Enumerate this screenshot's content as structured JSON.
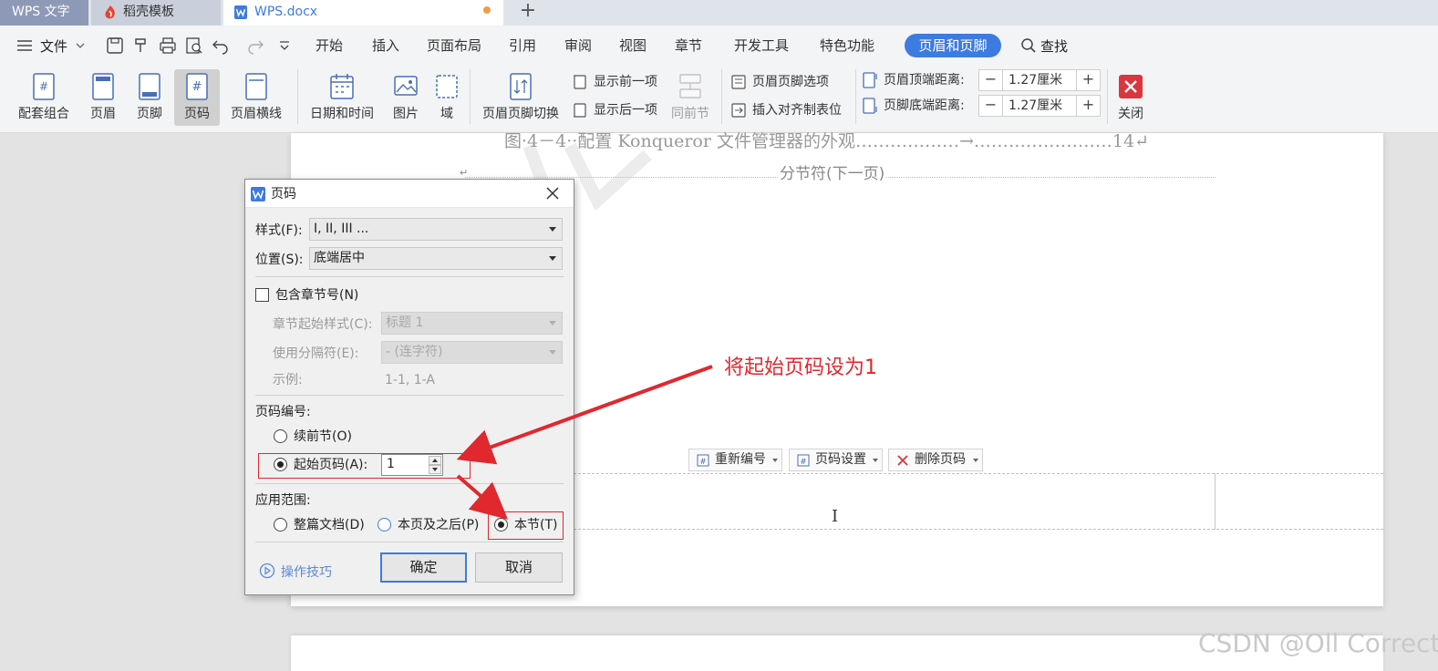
{
  "tabs": [
    {
      "label": "WPS 文字"
    },
    {
      "label": "稻壳模板"
    },
    {
      "label": "WPS.docx"
    }
  ],
  "menubar": {
    "file_label": "文件",
    "items": [
      "开始",
      "插入",
      "页面布局",
      "引用",
      "审阅",
      "视图",
      "章节",
      "开发工具",
      "特色功能"
    ],
    "active_tab": "页眉和页脚",
    "search_label": "查找"
  },
  "ribbon": {
    "large_buttons": [
      "配套组合",
      "页眉",
      "页脚",
      "页码",
      "页眉横线",
      "日期和时间",
      "图片",
      "域",
      "页眉页脚切换",
      "同前节",
      "关闭"
    ],
    "small_buttons": [
      "显示前一项",
      "显示后一项",
      "页眉页脚选项",
      "插入对齐制表位"
    ],
    "header_top_label": "页眉顶端距离:",
    "header_top_value": "1.27厘米",
    "footer_bottom_label": "页脚底端距离:",
    "footer_bottom_value": "1.27厘米"
  },
  "document": {
    "toc_line": "图·4－4··配置 Konqueror 文件管理器的外观………………→……………………14↵",
    "section_break": "分节符(下一页)",
    "paragraph_mark": "↵",
    "cursor": "I",
    "footer_buttons": [
      "重新编号",
      "页码设置",
      "删除页码"
    ]
  },
  "dialog": {
    "title": "页码",
    "style_label": "样式(F):",
    "style_value": "I, II, III ...",
    "position_label": "位置(S):",
    "position_value": "底端居中",
    "include_chapter_label": "包含章节号(N)",
    "chapter_style_label": "章节起始样式(C):",
    "chapter_style_value": "标题 1",
    "separator_label": "使用分隔符(E):",
    "separator_value": "-   (连字符)",
    "example_label": "示例:",
    "example_value": "1-1, 1-A",
    "numbering_header": "页码编号:",
    "continue_label": "续前节(O)",
    "start_label": "起始页码(A):",
    "start_value": "1",
    "scope_header": "应用范围:",
    "scope_whole": "整篇文档(D)",
    "scope_after": "本页及之后(P)",
    "scope_section": "本节(T)",
    "tips_label": "操作技巧",
    "ok_label": "确定",
    "cancel_label": "取消"
  },
  "annotation": {
    "text": "将起始页码设为1"
  },
  "watermark": "CSDN @Oll Correct",
  "colors": {
    "accent": "#3d7be0",
    "annotation_red": "#e0282e",
    "tab_active_bg": "#8d99b6"
  }
}
